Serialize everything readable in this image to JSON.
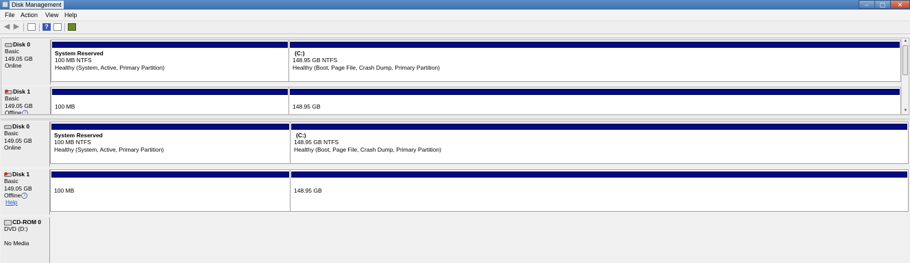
{
  "window": {
    "title": "Disk Management",
    "min": "–",
    "max": "▢",
    "close": "✕"
  },
  "menu": [
    "File",
    "Action",
    "View",
    "Help"
  ],
  "toolbar": {
    "back_icon": "back-arrow-icon",
    "forward_icon": "forward-arrow-icon",
    "help_glyph": "?"
  },
  "top_pane": {
    "disks": [
      {
        "name": "Disk 0",
        "type": "Basic",
        "size": "149.05 GB",
        "status": "Online",
        "partitions": [
          {
            "label": "System Reserved",
            "size": "100 MB NTFS",
            "status": "Healthy (System, Active, Primary Partition)"
          },
          {
            "label": "(C:)",
            "size": "148.95 GB NTFS",
            "status": "Healthy (Boot, Page File, Crash Dump, Primary Partition)"
          }
        ]
      },
      {
        "name": "Disk 1",
        "type": "Basic",
        "size": "149.05 GB",
        "status": "Offline",
        "partitions": [
          {
            "size": "100 MB"
          },
          {
            "size": "148.95 GB"
          }
        ]
      }
    ]
  },
  "bottom_pane": {
    "disks": [
      {
        "name": "Disk 0",
        "type": "Basic",
        "size": "149.05 GB",
        "status": "Online",
        "partitions": [
          {
            "label": "System Reserved",
            "size": "100 MB NTFS",
            "status": "Healthy (System, Active, Primary Partition)"
          },
          {
            "label": "(C:)",
            "size": "148.95 GB NTFS",
            "status": "Healthy (Boot, Page File, Crash Dump, Primary Partition)"
          }
        ]
      },
      {
        "name": "Disk 1",
        "type": "Basic",
        "size": "149.05 GB",
        "status": "Offline",
        "help": "Help",
        "partitions": [
          {
            "size": "100 MB"
          },
          {
            "size": "148.95 GB"
          }
        ]
      }
    ],
    "cdrom": {
      "name": "CD-ROM 0",
      "type": "DVD (D:)",
      "media": "No Media"
    }
  },
  "colors": {
    "partition_header": "#000c80",
    "title_bar": "#4a7cbf"
  }
}
